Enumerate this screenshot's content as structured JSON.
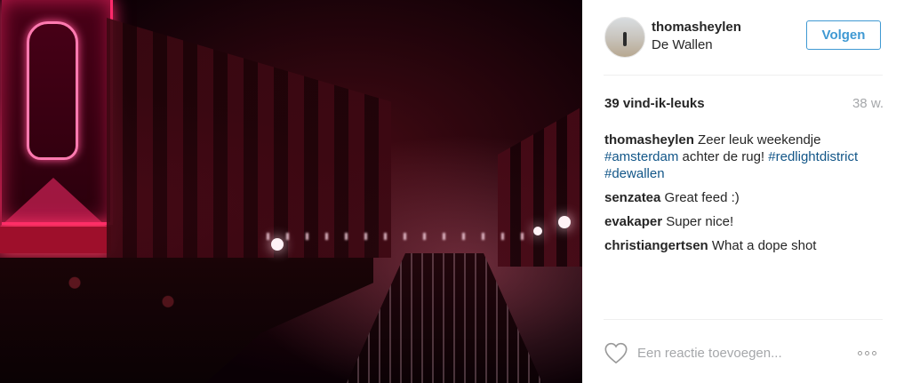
{
  "post": {
    "photo_description_icon": "photo",
    "user": {
      "username": "thomasheylen",
      "location": "De Wallen"
    },
    "follow_label": "Volgen",
    "likes_label": "39 vind-ik-leuks",
    "timestamp": "38 w."
  },
  "comments": [
    {
      "author": "thomasheylen",
      "parts": [
        {
          "type": "text",
          "value": " Zeer leuk weekendje "
        },
        {
          "type": "hashtag",
          "value": "#amsterdam"
        },
        {
          "type": "text",
          "value": " achter de rug! "
        },
        {
          "type": "hashtag",
          "value": "#redlightdistrict"
        },
        {
          "type": "text",
          "value": " "
        },
        {
          "type": "hashtag",
          "value": "#dewallen"
        }
      ]
    },
    {
      "author": "senzatea",
      "parts": [
        {
          "type": "text",
          "value": " Great feed :)"
        }
      ]
    },
    {
      "author": "evakaper",
      "parts": [
        {
          "type": "text",
          "value": " Super nice!"
        }
      ]
    },
    {
      "author": "christiangertsen",
      "parts": [
        {
          "type": "text",
          "value": " What a dope shot"
        }
      ]
    }
  ],
  "footer": {
    "comment_placeholder": "Een reactie toevoegen...",
    "like_icon": "heart-outline-icon",
    "more_icon": "more-options-icon"
  },
  "colors": {
    "link_blue": "#3f99d3",
    "hashtag_blue": "#125688",
    "muted_gray": "#a5a7aa",
    "text": "#262626"
  }
}
